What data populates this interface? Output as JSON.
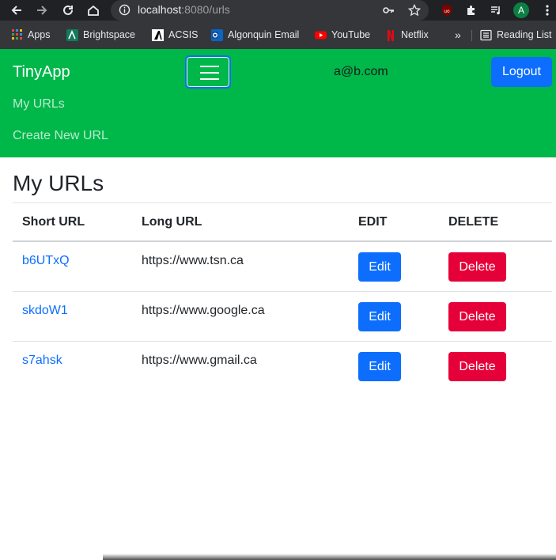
{
  "browser": {
    "url_host": "localhost",
    "url_rest": ":8080/urls",
    "profile_initial": "A",
    "bookmarks": [
      {
        "label": "Apps",
        "icon": "apps-grid-icon"
      },
      {
        "label": "Brightspace",
        "icon": "brightspace-icon"
      },
      {
        "label": "ACSIS",
        "icon": "acsis-icon"
      },
      {
        "label": "Algonquin Email",
        "icon": "outlook-icon"
      },
      {
        "label": "YouTube",
        "icon": "youtube-icon"
      },
      {
        "label": "Netflix",
        "icon": "netflix-icon"
      }
    ],
    "overflow": "»",
    "reading_list": "Reading List"
  },
  "navbar": {
    "brand": "TinyApp",
    "email": "a@b.com",
    "logout_label": "Logout",
    "links": [
      "My URLs",
      "Create New URL"
    ]
  },
  "main": {
    "title": "My URLs",
    "columns": [
      "Short URL",
      "Long URL",
      "EDIT",
      "DELETE"
    ],
    "rows": [
      {
        "short": "b6UTxQ",
        "long": "https://www.tsn.ca",
        "edit": "Edit",
        "delete": "Delete"
      },
      {
        "short": "skdoW1",
        "long": "https://www.google.ca",
        "edit": "Edit",
        "delete": "Delete"
      },
      {
        "short": "s7ahsk",
        "long": "https://www.gmail.ca",
        "edit": "Edit",
        "delete": "Delete"
      }
    ]
  },
  "colors": {
    "navbar_bg": "#00b74a",
    "primary": "#0d6efd",
    "danger": "#e60039"
  }
}
